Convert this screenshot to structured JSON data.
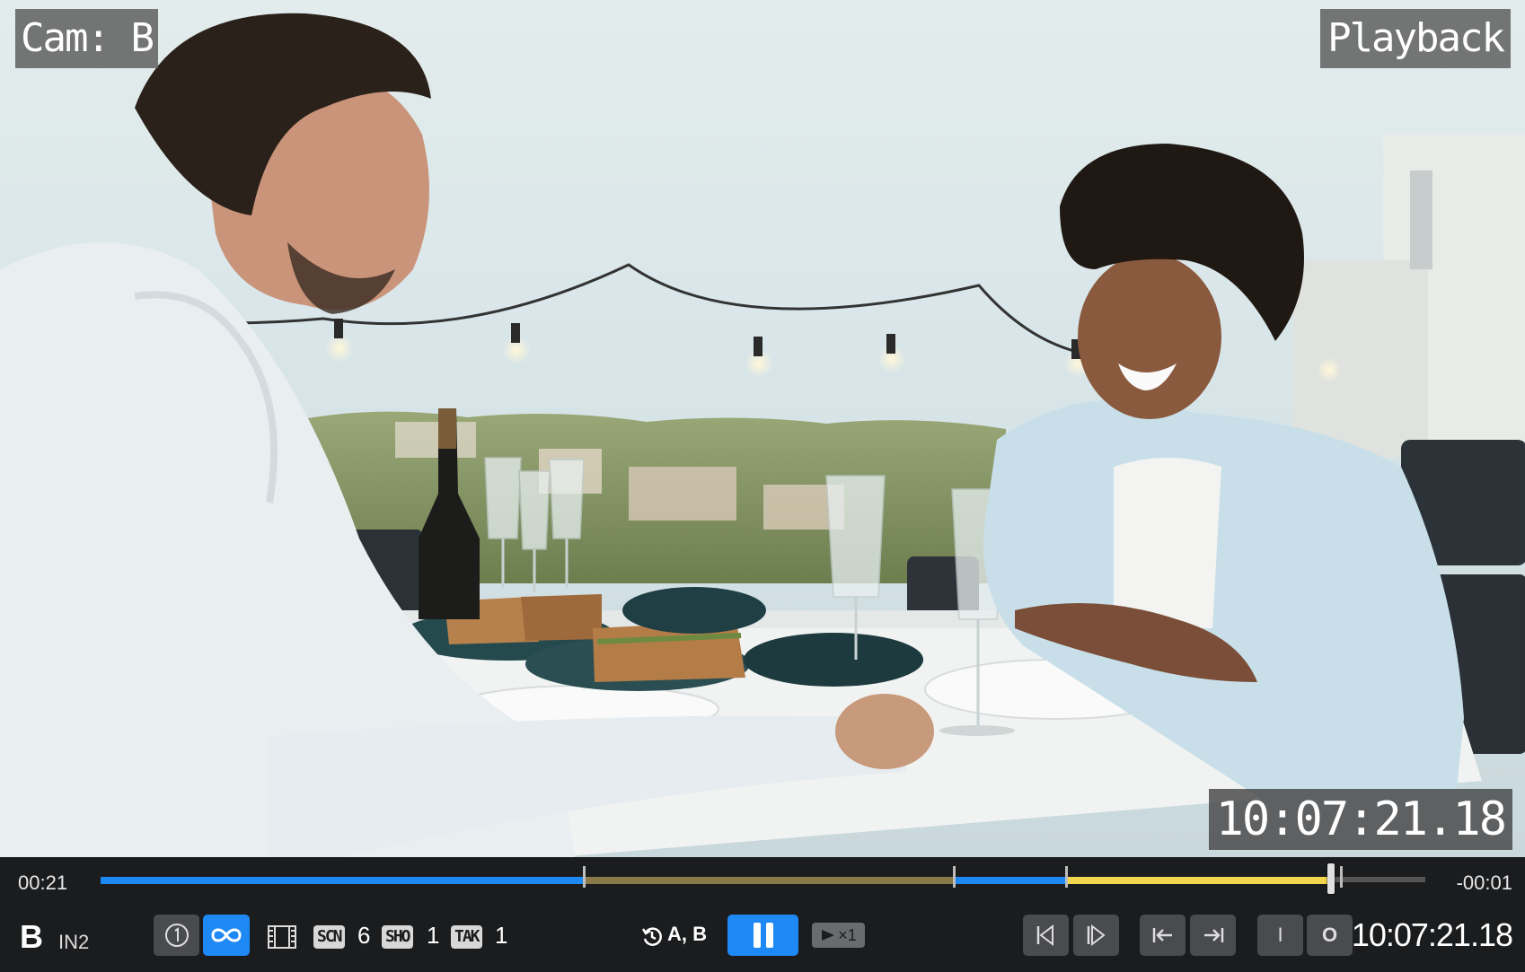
{
  "overlays": {
    "camera": "Cam: B",
    "mode": "Playback",
    "frame_timecode": "10:07:21.18"
  },
  "transport": {
    "elapsed": "00:21",
    "remaining": "-00:01",
    "progress_fraction": 0.929,
    "segments_fraction": [
      {
        "start": 0.0,
        "end": 0.365,
        "color": "#1e88f5"
      },
      {
        "start": 0.365,
        "end": 0.644,
        "color": "#8a7a4a"
      },
      {
        "start": 0.644,
        "end": 0.729,
        "color": "#1e88f5"
      },
      {
        "start": 0.729,
        "end": 0.929,
        "color": "#f2d64b"
      },
      {
        "start": 0.929,
        "end": 1.0,
        "color": "#555555"
      }
    ],
    "markers_fraction": [
      0.365,
      0.644,
      0.729,
      0.936
    ]
  },
  "controls": {
    "camera_letter": "B",
    "input": "IN2",
    "scene_badge": "SCN",
    "scene_number": "6",
    "shot_badge": "SHO",
    "shot_number": "1",
    "take_badge": "TAK",
    "take_number": "1",
    "ab_sources": "A, B",
    "speed_label": "×1",
    "timecode": "10:07:21.18",
    "in_label": "I",
    "out_label": "O"
  },
  "icons": [
    "single-play-icon",
    "loop-icon",
    "film-strip-icon",
    "ab-sync-icon",
    "pause-icon",
    "play-speed-icon",
    "step-back-icon",
    "step-forward-icon",
    "go-to-in-icon",
    "go-to-out-icon"
  ],
  "colors": {
    "accent": "#1e88f5",
    "bar_bg": "#1b1c1e",
    "button_bg": "#4a4b4e",
    "highlight_yellow": "#f2d64b"
  }
}
